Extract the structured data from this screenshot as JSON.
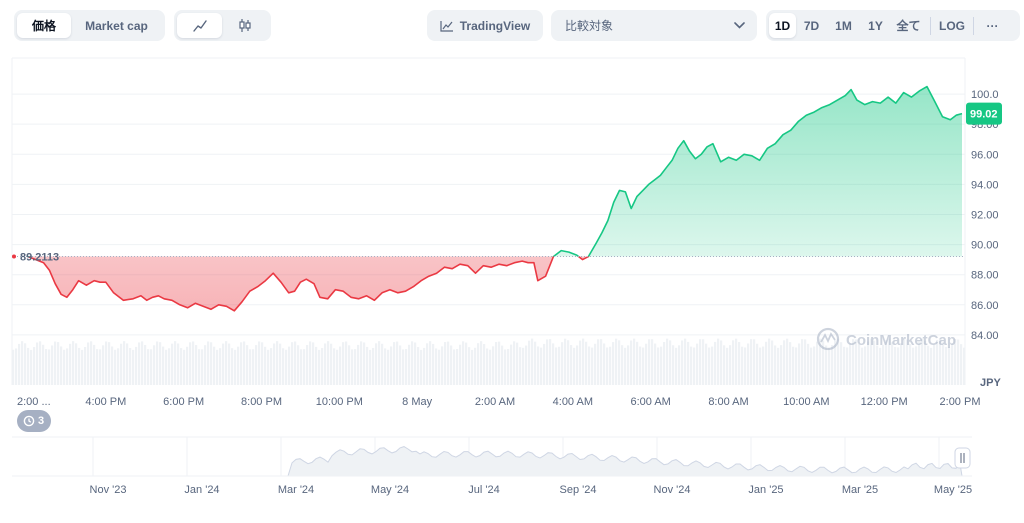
{
  "toolbar": {
    "price_tab": "価格",
    "marketcap_tab": "Market cap",
    "line_icon": "line-chart-icon",
    "candle_icon": "candlestick-icon",
    "tradingview_label": "TradingView",
    "compare_label": "比較対象",
    "ranges": [
      "1D",
      "7D",
      "1M",
      "1Y",
      "全て"
    ],
    "active_range": "1D",
    "log_label": "LOG",
    "more_label": "···"
  },
  "chart_data": {
    "type": "area",
    "currency": "JPY",
    "reference_price": 89.2113,
    "reference_label": "89.2113",
    "last_price_label": "99.02",
    "ylim": [
      82.0,
      101.6
    ],
    "y_ticks": [
      "100.0",
      "98.00",
      "96.00",
      "94.00",
      "92.00",
      "90.00",
      "88.00",
      "86.00",
      "84.00"
    ],
    "x_ticks": [
      "2:00 ...",
      "4:00 PM",
      "6:00 PM",
      "8:00 PM",
      "10:00 PM",
      "8 May",
      "2:00 AM",
      "4:00 AM",
      "6:00 AM",
      "8:00 AM",
      "10:00 AM",
      "12:00 PM",
      "2:00 PM"
    ],
    "x_hours": [
      0,
      2,
      4,
      6,
      8,
      10,
      12,
      14,
      16,
      18,
      20,
      22,
      24
    ],
    "series": [
      {
        "hours": [
          0,
          0.2,
          0.4,
          0.55,
          0.7,
          0.85,
          1.0,
          1.15,
          1.3,
          1.5,
          1.7,
          1.85,
          2.0,
          2.2,
          2.45,
          2.7,
          2.9,
          3.05,
          3.2,
          3.35,
          3.5,
          3.7,
          3.9,
          4.1,
          4.3,
          4.5,
          4.7,
          4.9,
          5.1,
          5.3,
          5.5,
          5.7,
          5.9,
          6.1,
          6.3,
          6.5,
          6.7,
          6.85,
          7.0,
          7.15,
          7.35,
          7.5,
          7.7,
          7.9,
          8.1,
          8.3,
          8.5,
          8.7,
          8.9,
          9.1,
          9.3,
          9.5,
          9.7,
          9.9,
          10.1,
          10.3,
          10.5,
          10.7,
          10.9,
          11.1,
          11.3,
          11.5,
          11.7,
          11.9,
          12.1,
          12.3,
          12.5,
          12.7,
          12.85,
          13.0,
          13.1,
          13.3,
          13.5,
          13.7,
          13.9,
          14.1,
          14.25,
          14.4,
          14.6,
          14.75,
          14.9,
          15.05,
          15.2,
          15.35,
          15.5,
          15.65,
          15.8,
          15.95,
          16.1,
          16.25,
          16.4,
          16.55,
          16.7,
          16.85,
          17.0,
          17.15,
          17.3,
          17.45,
          17.6,
          17.8,
          18.0,
          18.2,
          18.4,
          18.6,
          18.8,
          19.0,
          19.2,
          19.4,
          19.6,
          19.8,
          20.0,
          20.2,
          20.4,
          20.6,
          20.8,
          21.0,
          21.15,
          21.3,
          21.5,
          21.7,
          21.9,
          22.1,
          22.3,
          22.5,
          22.7,
          22.9,
          23.1,
          23.3,
          23.5,
          23.7,
          23.85,
          24.0
        ],
        "values": [
          89.2,
          89.0,
          88.8,
          88.3,
          87.4,
          86.7,
          86.5,
          87.0,
          87.6,
          87.3,
          87.6,
          87.5,
          87.5,
          86.8,
          86.3,
          86.4,
          86.6,
          86.3,
          86.5,
          86.6,
          86.4,
          86.3,
          86.0,
          85.8,
          86.1,
          85.9,
          85.7,
          86.0,
          85.9,
          85.6,
          86.2,
          86.9,
          87.2,
          87.6,
          88.1,
          87.5,
          86.8,
          86.9,
          87.5,
          87.7,
          87.4,
          86.5,
          86.4,
          87.0,
          86.9,
          86.5,
          86.4,
          86.6,
          86.3,
          86.8,
          87.0,
          86.8,
          86.9,
          87.2,
          87.6,
          87.9,
          88.1,
          88.5,
          88.4,
          88.7,
          88.6,
          88.1,
          88.6,
          88.5,
          88.7,
          88.6,
          88.8,
          88.9,
          88.8,
          88.8,
          87.6,
          87.9,
          89.2,
          89.6,
          89.5,
          89.3,
          89.0,
          89.2,
          90.1,
          90.8,
          91.6,
          92.8,
          93.6,
          93.5,
          92.4,
          93.2,
          93.6,
          94.0,
          94.3,
          94.6,
          95.1,
          95.6,
          96.4,
          96.9,
          96.2,
          95.7,
          96.0,
          96.5,
          96.7,
          95.5,
          95.8,
          95.6,
          96.0,
          95.9,
          95.6,
          96.4,
          96.7,
          97.3,
          97.6,
          98.2,
          98.6,
          98.8,
          99.1,
          99.3,
          99.6,
          99.9,
          100.3,
          99.6,
          99.3,
          99.5,
          99.4,
          99.8,
          99.4,
          100.1,
          99.8,
          100.2,
          100.5,
          99.5,
          98.5,
          98.3,
          98.6,
          98.7,
          99.0,
          99.02
        ]
      }
    ],
    "up_color": "#16c784",
    "down_color": "#ea3943"
  },
  "volume": {
    "baseline_level": 0.42,
    "late_level": 0.48
  },
  "navigator": {
    "x_ticks": [
      "Nov '23",
      "Jan '24",
      "Mar '24",
      "May '24",
      "Jul '24",
      "Sep '24",
      "Nov '24",
      "Jan '25",
      "Mar '25",
      "May '25"
    ],
    "handle_icon": "pause-handle-icon"
  },
  "watermark": "CoinMarketCap",
  "history_badge": {
    "icon": "clock-history-icon",
    "count": "3"
  }
}
